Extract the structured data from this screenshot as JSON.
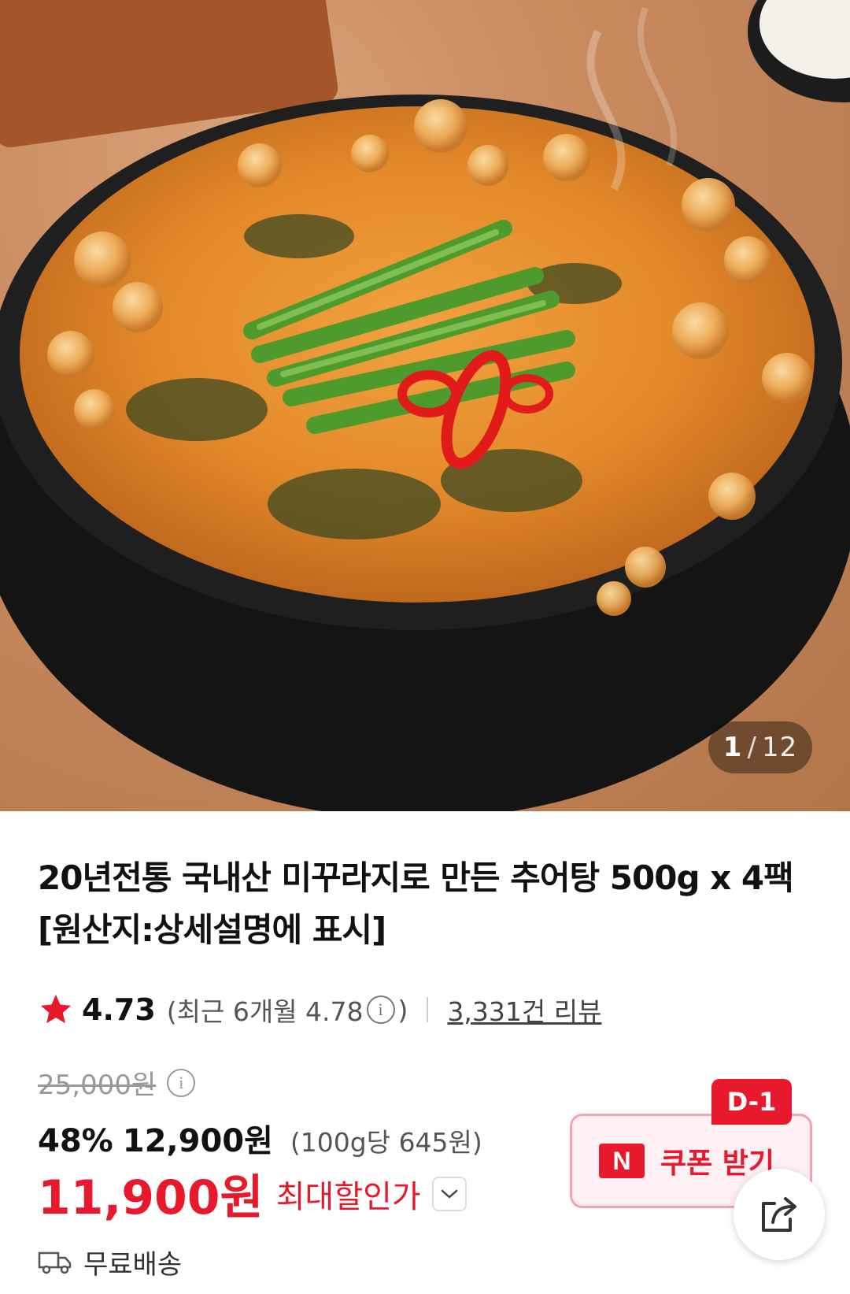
{
  "gallery": {
    "current": "1",
    "separator": "/",
    "total": "12"
  },
  "product": {
    "title": "20년전통 국내산 미꾸라지로 만든 추어탕 500g x 4팩 [원산지:상세설명에 표시]"
  },
  "rating": {
    "score": "4.73",
    "recent_prefix": "(최근 6개월 4.78",
    "recent_suffix": ")",
    "review_count": "3,331건 리뷰",
    "star_color": "#e8192c"
  },
  "price": {
    "original": "25,000원",
    "discount_rate": "48%",
    "sale": "12,900원",
    "unit": "(100g당 645원)",
    "best": "11,900원",
    "best_label": "최대할인가",
    "accent_color": "#e8192c"
  },
  "coupon": {
    "badge": "D-1",
    "logo": "N",
    "label": "쿠폰 받기"
  },
  "shipping": {
    "label": "무료배송",
    "icon": "truck-icon"
  },
  "actions": {
    "share_icon": "share-icon"
  }
}
